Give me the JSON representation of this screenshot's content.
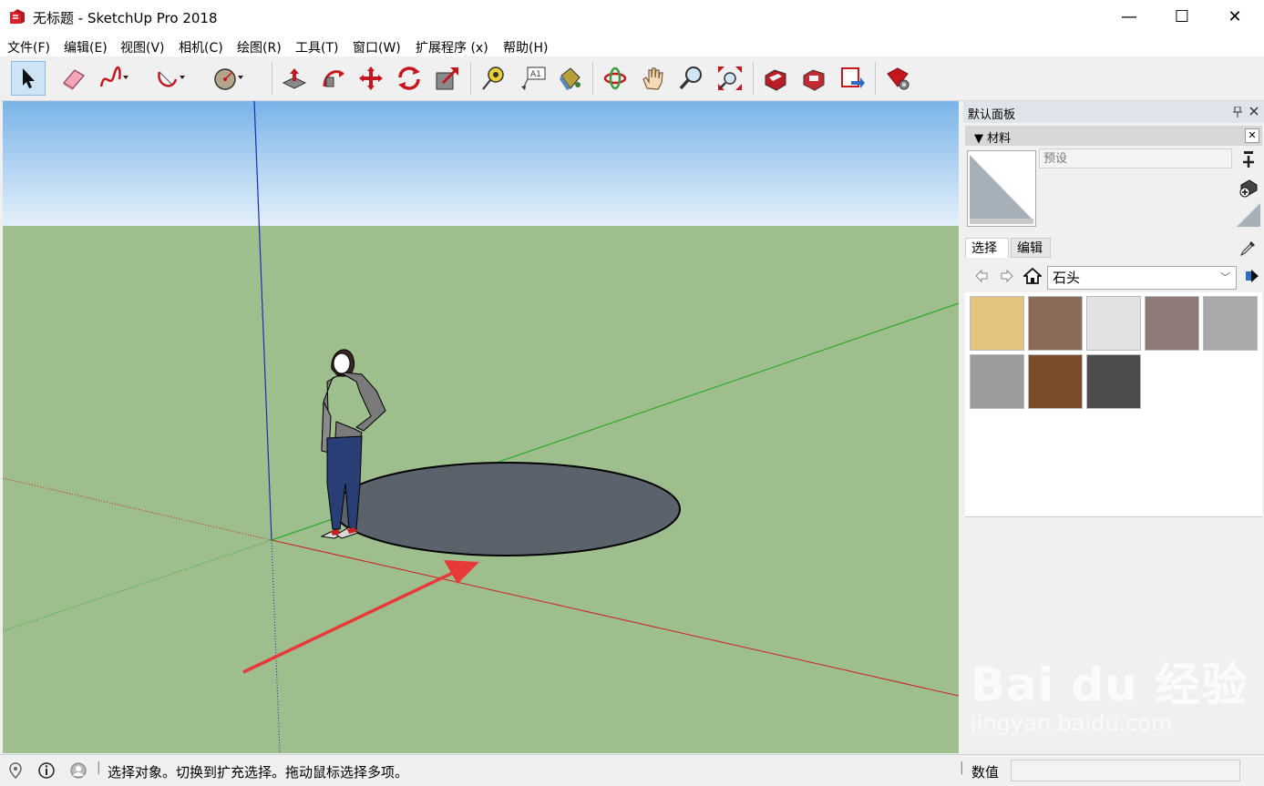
{
  "window": {
    "title": "无标题 - SketchUp Pro 2018",
    "controls": {
      "minimize": "—",
      "maximize": "☐",
      "close": "✕"
    }
  },
  "menu": [
    "文件(F)",
    "编辑(E)",
    "视图(V)",
    "相机(C)",
    "绘图(R)",
    "工具(T)",
    "窗口(W)",
    "扩展程序 (x)",
    "帮助(H)"
  ],
  "toolbar": [
    "select-icon",
    "eraser-icon",
    "freehand-icon",
    "arc-icon",
    "circle-icon",
    "push-pull-icon",
    "follow-me-icon",
    "move-icon",
    "rotate-icon",
    "scale-icon",
    "tape-measure-icon",
    "text-icon",
    "paint-bucket-icon",
    "orbit-icon",
    "pan-icon",
    "zoom-icon",
    "zoom-extents-icon",
    "3d-warehouse-icon",
    "extension-warehouse-icon",
    "send-to-layout-icon",
    "extension-manager-icon"
  ],
  "panel": {
    "title": "默认面板",
    "tray_title": "▼ 材料",
    "name_placeholder": "预设",
    "tabs": {
      "select": "选择",
      "edit": "编辑"
    },
    "collection": "石头",
    "swatches": [
      "#e3c37d",
      "#8a6a58",
      "#e2e2e2",
      "#8e7a78",
      "#a9a9a9",
      "#9c9c9c",
      "#7a4c2a",
      "#4c4c4c"
    ]
  },
  "status": {
    "message": "选择对象。切换到扩充选择。拖动鼠标选择多项。",
    "measurements_label": "数值",
    "measurements_value": ""
  },
  "watermark": {
    "brand": "Bai du 经验",
    "url": "jingyan.baidu.com"
  }
}
